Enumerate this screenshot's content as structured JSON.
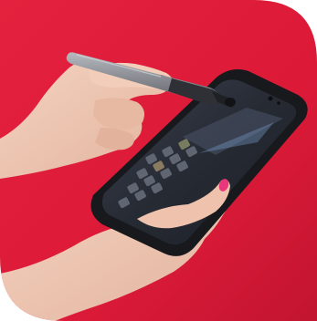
{
  "photo": {
    "subject": "hands-holding-smartphone-with-stylus-pen",
    "colors": {
      "background": "#e01f3d",
      "background_shadow": "#b8142c",
      "skin": "#f1c9b4",
      "skin_shadow": "#d9a48e",
      "nails": "#e8377a",
      "phone_body": "#1f2126",
      "screen": "#2b2f38",
      "pen_barrel": "#8a8d93",
      "pen_grip": "#3a3c41"
    }
  }
}
